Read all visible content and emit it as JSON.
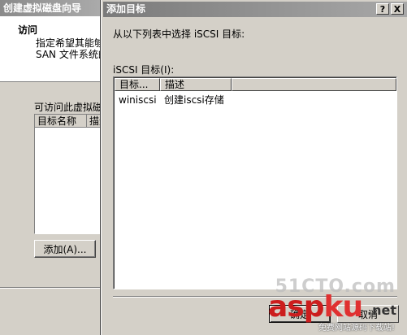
{
  "wizard": {
    "title": "创建虚拟磁盘向导",
    "heading": "访问",
    "description_line1": "指定希望其能够",
    "description_line2": "SAN 文件系统的",
    "access_label": "可访问此虚拟磁",
    "list_columns": [
      "目标名称",
      "描述"
    ],
    "add_button": "添加(A)..."
  },
  "dialog": {
    "title": "添加目标",
    "help_button": "?",
    "close_button": "X",
    "instruction": "从以下列表中选择 iSCSI 目标:",
    "target_label": "iSCSI 目标(I):",
    "columns": [
      "目标...",
      "描述"
    ],
    "rows": [
      {
        "name": "winiscsi",
        "description": "创建iscsi存储"
      }
    ],
    "ok_button": "确定",
    "cancel_button": "取消"
  },
  "watermark": {
    "top": "51CTO.com",
    "brand_main": "asp",
    "brand_accent": "ku",
    "brand_suffix": ".net",
    "subtitle": "免费网站源码下载站!"
  }
}
